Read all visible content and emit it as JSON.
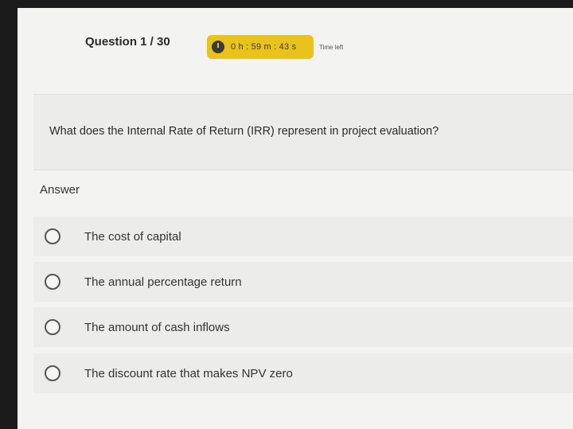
{
  "header": {
    "question_counter": "Question 1 / 30",
    "timer": "0 h : 59 m : 43 s",
    "time_left_label": "Time left"
  },
  "question": {
    "text": "What does the Internal Rate of Return (IRR) represent in project evaluation?"
  },
  "answer": {
    "label": "Answer",
    "options": [
      {
        "label": "The cost of capital"
      },
      {
        "label": "The annual percentage return"
      },
      {
        "label": "The amount of cash inflows"
      },
      {
        "label": "The discount rate that makes NPV zero"
      }
    ]
  },
  "colors": {
    "timer_badge": "#e9c31c",
    "background": "#f3f3f1",
    "card": "#ececea"
  }
}
